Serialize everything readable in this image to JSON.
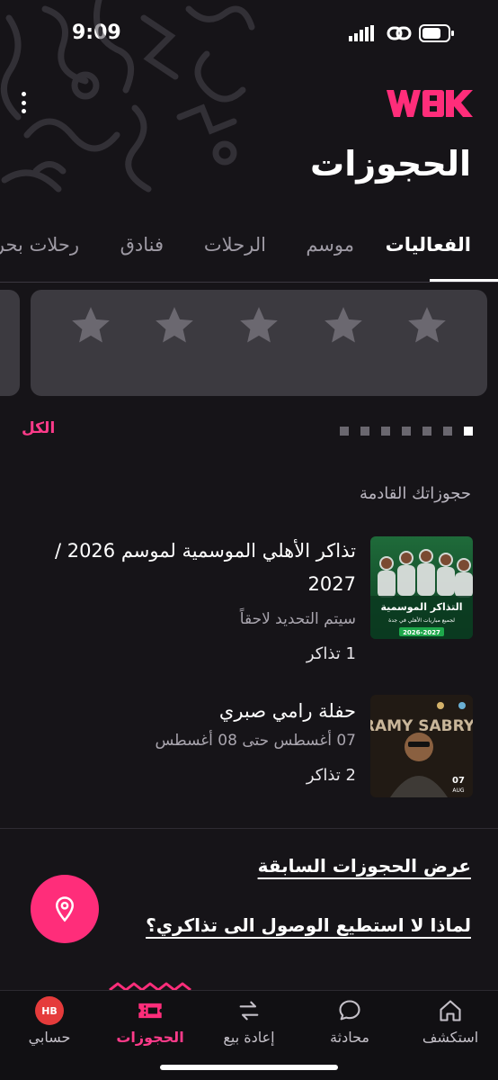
{
  "status_bar": {
    "time": "9:09"
  },
  "header": {
    "logo": "WBK",
    "title": "الحجوزات"
  },
  "tabs": [
    {
      "label": "الفعاليات",
      "active": true
    },
    {
      "label": "موسم",
      "active": false
    },
    {
      "label": "الرحلات",
      "active": false
    },
    {
      "label": "فنادق",
      "active": false
    },
    {
      "label": "رحلات بحرية",
      "active": false
    }
  ],
  "rating_card": {
    "stars": 5
  },
  "carousel": {
    "all_label": "الكل",
    "pages": 7,
    "active_page": 0
  },
  "upcoming": {
    "title": "حجوزاتك القادمة",
    "items": [
      {
        "title": "تذاكر الأهلي الموسمية لموسم 2026 / 2027",
        "subtitle": "سيتم التحديد لاحقاً",
        "count": "1 تذاكر",
        "thumb_heading": "التذاكر الموسمية",
        "thumb_sub": "لجميع مباريات الأهلي في جدة",
        "thumb_years": "2026-2027"
      },
      {
        "title": "حفلة رامي صبري",
        "subtitle": "07 أغسطس حتى 08 أغسطس",
        "count": "2 تذاكر",
        "thumb_heading": "RAMY SABRY",
        "thumb_day": "07",
        "thumb_month": "AUG"
      }
    ]
  },
  "links": {
    "past_bookings": "عرض الحجوزات السابقة",
    "help": "لماذا لا استطيع الوصول الى تذاكري؟"
  },
  "bottom_nav": [
    {
      "label": "استكشف",
      "icon": "home-icon"
    },
    {
      "label": "محادثة",
      "icon": "chat-icon"
    },
    {
      "label": "إعادة بيع",
      "icon": "resale-icon"
    },
    {
      "label": "الحجوزات",
      "icon": "ticket-icon",
      "active": true
    },
    {
      "label": "حسابي",
      "icon": "avatar",
      "initials": "HB"
    }
  ],
  "colors": {
    "accent": "#ff2d7a",
    "background": "#161418",
    "card": "#3c3a40"
  }
}
